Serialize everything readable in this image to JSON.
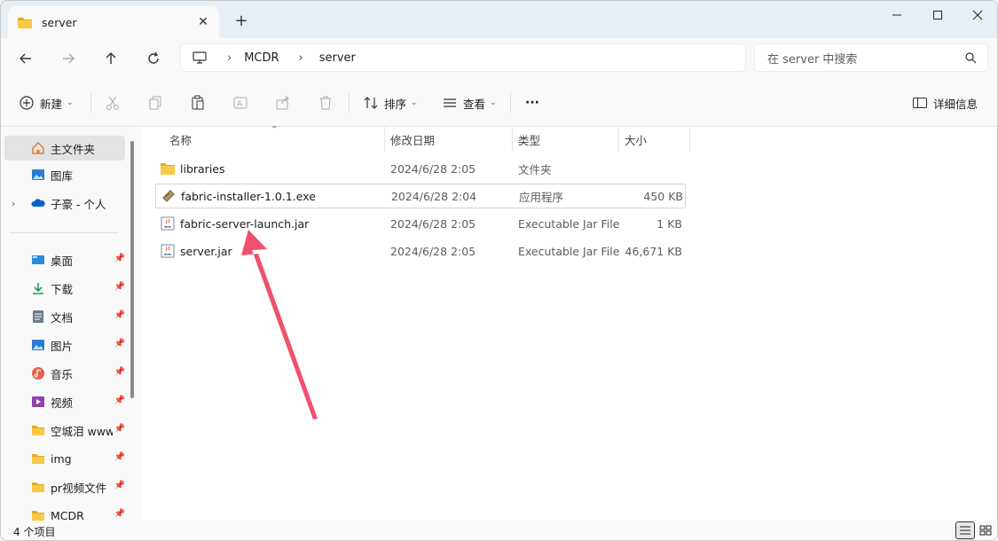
{
  "window": {
    "tab_title": "server",
    "new_tab_symbol": "+"
  },
  "address": {
    "crumbs": [
      "MCDR",
      "server"
    ],
    "search_placeholder": "在 server 中搜索"
  },
  "toolbar": {
    "new_label": "新建",
    "sort_label": "排序",
    "view_label": "查看",
    "more_label": "···",
    "details_label": "详细信息"
  },
  "sidebar": {
    "top_items": [
      {
        "label": "主文件夹",
        "icon": "home-icon"
      },
      {
        "label": "图库",
        "icon": "gallery-icon"
      },
      {
        "label": "子豪 - 个人",
        "icon": "onedrive-cloud-icon"
      }
    ],
    "quick_items": [
      {
        "label": "桌面",
        "icon": "desktop-icon"
      },
      {
        "label": "下载",
        "icon": "download-icon"
      },
      {
        "label": "文档",
        "icon": "documents-icon"
      },
      {
        "label": "图片",
        "icon": "pictures-icon"
      },
      {
        "label": "音乐",
        "icon": "music-icon"
      },
      {
        "label": "视频",
        "icon": "videos-icon"
      },
      {
        "label": "空城泪 www",
        "icon": "folder-icon"
      },
      {
        "label": "img",
        "icon": "folder-icon"
      },
      {
        "label": "pr视频文件",
        "icon": "folder-icon"
      },
      {
        "label": "MCDR",
        "icon": "folder-icon"
      }
    ]
  },
  "columns": {
    "name": "名称",
    "date": "修改日期",
    "type": "类型",
    "size": "大小"
  },
  "files": [
    {
      "name": "libraries",
      "date": "2024/6/28 2:05",
      "type": "文件夹",
      "size": "",
      "icon": "folder-icon"
    },
    {
      "name": "fabric-installer-1.0.1.exe",
      "date": "2024/6/28 2:04",
      "type": "应用程序",
      "size": "450 KB",
      "icon": "exe-icon"
    },
    {
      "name": "fabric-server-launch.jar",
      "date": "2024/6/28 2:05",
      "type": "Executable Jar File",
      "size": "1 KB",
      "icon": "jar-icon"
    },
    {
      "name": "server.jar",
      "date": "2024/6/28 2:05",
      "type": "Executable Jar File",
      "size": "46,671 KB",
      "icon": "jar-icon"
    }
  ],
  "status": {
    "item_count": "4 个项目"
  },
  "colors": {
    "folder": "#f7c948",
    "folder_dark": "#e3a920",
    "annotation_arrow": "#f0506e",
    "accent": "#0067c0"
  }
}
